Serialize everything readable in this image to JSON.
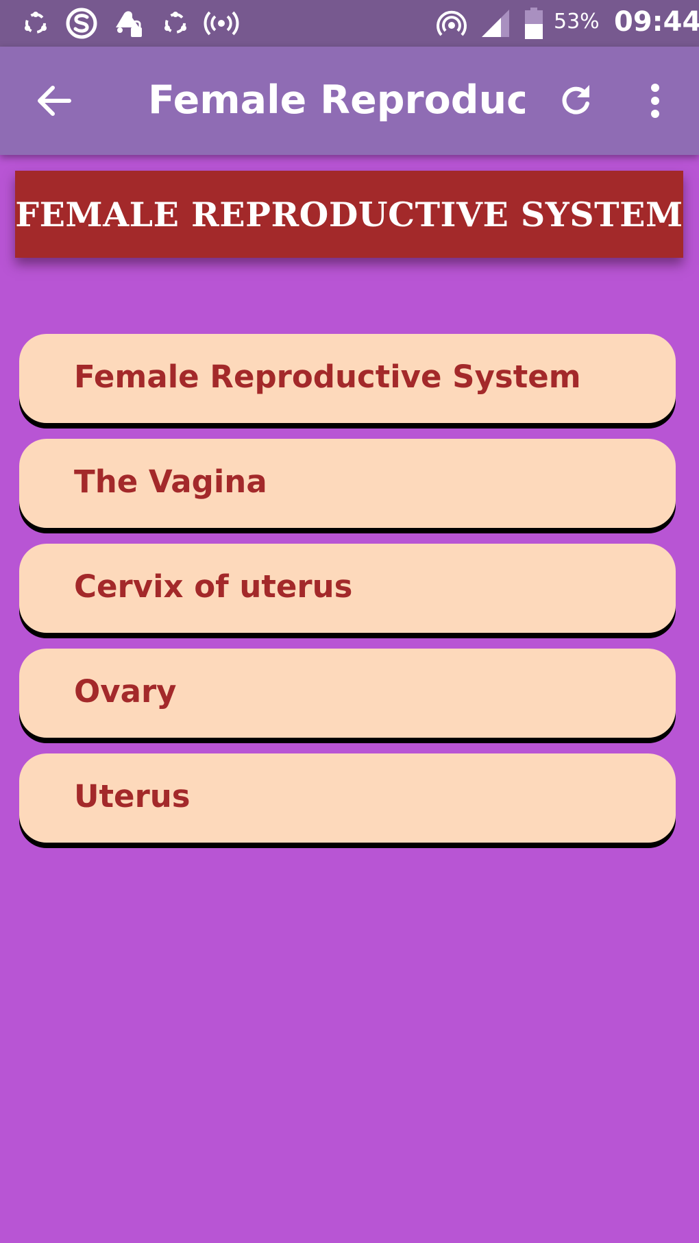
{
  "status_bar": {
    "icons": [
      "shareit-icon",
      "s-app-icon",
      "notification-lock-icon",
      "shareit-icon",
      "hotspot-broadcast-icon",
      "wifi-hotspot-icon",
      "signal-icon",
      "battery-icon"
    ],
    "battery": "53%",
    "time": "09:44"
  },
  "app_bar": {
    "back_icon": "arrow-left-icon",
    "title": "Female Reproductiv…",
    "refresh_icon": "refresh-icon",
    "more_icon": "more-vertical-icon"
  },
  "banner": {
    "text": "FEMALE REPRODUCTIVE SYSTEM"
  },
  "menu": {
    "items": [
      {
        "label": "Female Reproductive System"
      },
      {
        "label": "The Vagina"
      },
      {
        "label": "Cervix of uterus"
      },
      {
        "label": "Ovary"
      },
      {
        "label": "Uterus"
      }
    ]
  },
  "colors": {
    "status_bar": "#77598f",
    "app_bar": "#8f6cb4",
    "background": "#b855d4",
    "banner": "#a3292a",
    "item_background": "#fdd9bb",
    "item_text": "#a3292a"
  }
}
